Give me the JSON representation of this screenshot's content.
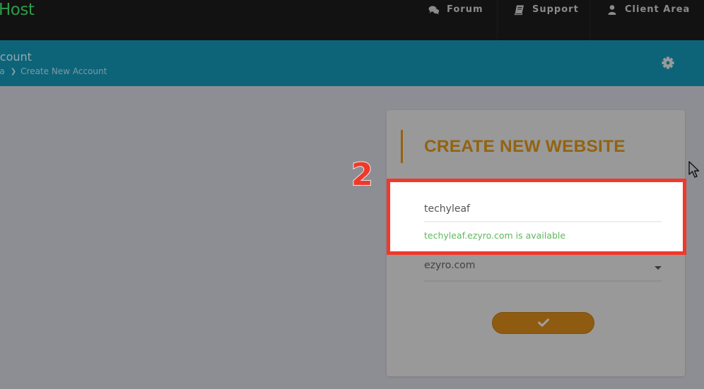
{
  "navbar": {
    "brand": "Host",
    "items": [
      {
        "label": "Forum",
        "icon": "comments-icon"
      },
      {
        "label": "Support",
        "icon": "book-icon"
      },
      {
        "label": "Client Area",
        "icon": "user-icon"
      }
    ]
  },
  "header": {
    "title": "ccount",
    "breadcrumb": [
      {
        "label": "ea"
      },
      {
        "label": "Create New Account"
      }
    ],
    "settings_icon": "gear-icon"
  },
  "card": {
    "title": "CREATE NEW WEBSITE",
    "subdomain_value": "techyleaf",
    "availability_message": "techyleaf.ezyro.com is available",
    "domain_selected": "ezyro.com",
    "submit_icon": "check-icon"
  },
  "annotation": {
    "step_number": "2",
    "highlight_color": "#f1382a"
  },
  "colors": {
    "brand_green": "#2e9a49",
    "header_teal": "#0d6479",
    "accent_orange": "#93630f",
    "success_green": "#5cb85c"
  }
}
